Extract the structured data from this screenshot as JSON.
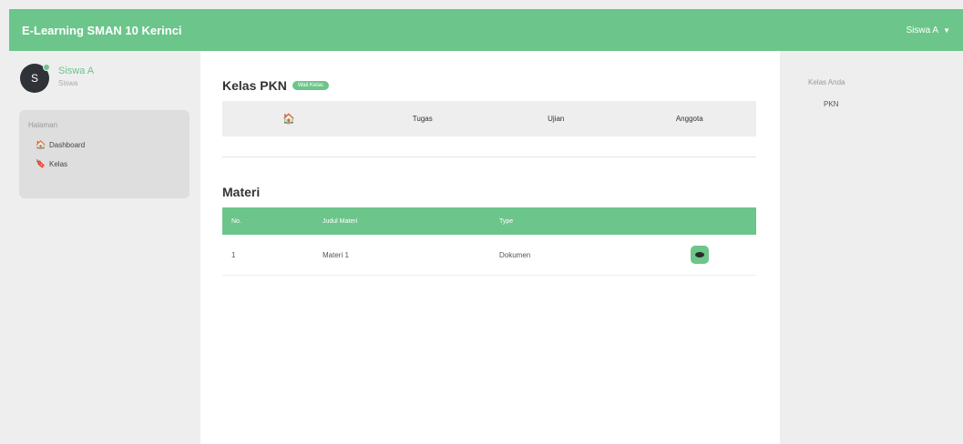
{
  "topbar": {
    "brand": "E-Learning SMAN 10 Kerinci",
    "user_menu_label": "Siswa A",
    "caret_icon": "caret-down-icon"
  },
  "profile": {
    "avatar_initial": "S",
    "name": "Siswa A",
    "role": "Siswa"
  },
  "sidebar": {
    "header": "Halaman",
    "items": [
      {
        "label": "Dashboard",
        "icon": "home-icon",
        "glyph": "🏠"
      },
      {
        "label": "Kelas",
        "icon": "bookmark-icon",
        "glyph": "🔖"
      }
    ]
  },
  "main": {
    "class_title": "Kelas PKN",
    "badge": "Wali Kelas",
    "tabs": [
      {
        "label": "",
        "icon": "home-icon",
        "glyph": "🏠"
      },
      {
        "label": "Tugas"
      },
      {
        "label": "Ujian"
      },
      {
        "label": "Anggota"
      }
    ],
    "materi_title": "Materi",
    "table": {
      "headers": [
        "No.",
        "Judul Materi",
        "Type"
      ],
      "rows": [
        {
          "no": "1",
          "judul": "Materi 1",
          "type": "Dokumen",
          "action_icon": "eye-icon"
        }
      ]
    }
  },
  "right_panel": {
    "header": "Kelas Anda",
    "items": [
      "PKN"
    ]
  },
  "colors": {
    "accent": "#6cc58a",
    "background": "#eeeeee",
    "card": "#dedede",
    "dark": "#2f3338"
  }
}
